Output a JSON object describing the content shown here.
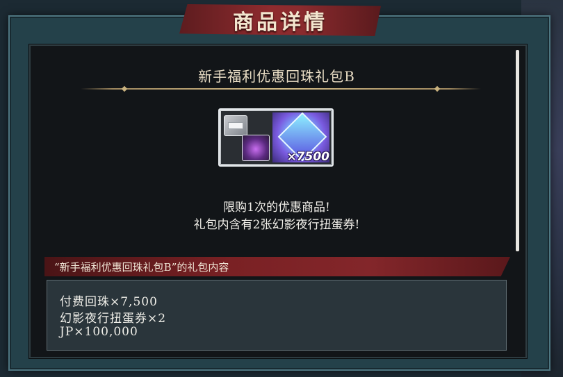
{
  "header": {
    "title": "商品详情"
  },
  "package": {
    "name": "新手福利优惠回珠礼包B",
    "gem_count": "×7500",
    "description": [
      "限购1次的优惠商品!",
      "礼包内含有2张幻影夜行扭蛋券!"
    ]
  },
  "contents": {
    "header": "“新手福利优惠回珠礼包B”的礼包内容",
    "items": [
      "付费回珠×7,500",
      "幻影夜行扭蛋券×2",
      "JP×100,000"
    ]
  },
  "icons": {
    "ticket": "gacha-ticket-icon",
    "flame": "phantom-flame-icon",
    "gem": "paid-gem-icon"
  },
  "colors": {
    "banner_red": "#8e2b2e",
    "frame_teal": "#24414a",
    "panel_dark": "#121518",
    "gold_divider": "#d7c08b"
  }
}
